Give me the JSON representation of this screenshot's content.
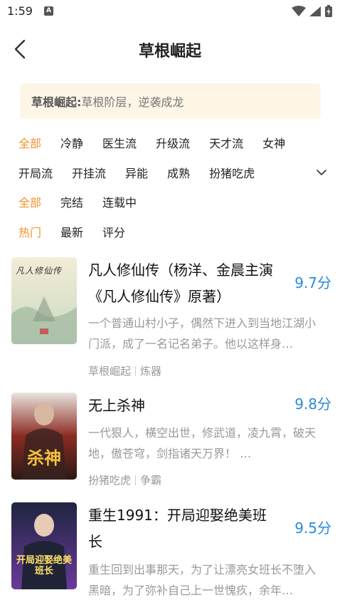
{
  "status": {
    "time": "1:59",
    "notification_letter": "A"
  },
  "header": {
    "title": "草根崛起"
  },
  "banner": {
    "label": "草根崛起:",
    "text": "草根阶层，逆袭成龙"
  },
  "filters": {
    "category_row1": [
      "全部",
      "冷静",
      "医生流",
      "升级流",
      "天才流",
      "女神"
    ],
    "category_row2": [
      "开局流",
      "开挂流",
      "异能",
      "成熟",
      "扮猪吃虎"
    ],
    "status_options": [
      "全部",
      "完结",
      "连载中"
    ],
    "sort_options": [
      "热门",
      "最新",
      "评分"
    ]
  },
  "books": [
    {
      "title": "凡人修仙传（杨洋、金晨主演《凡人修仙传》原著）",
      "score": "9.7分",
      "desc": "一个普通山村小子，偶然下进入到当地江湖小门派，成了一名记名弟子。他以这样身…",
      "tag1": "草根崛起",
      "tag2": "炼器",
      "cover_text": "凡人修仙传"
    },
    {
      "title": "无上杀神",
      "score": "9.8分",
      "desc": "一代狠人，横空出世，修武道，凌九霄，破天地，傲苍穹，剑指诸天万界！ …",
      "tag1": "扮猪吃虎",
      "tag2": "争霸",
      "cover_text": "杀神"
    },
    {
      "title": "重生1991：开局迎娶绝美班长",
      "score": "9.5分",
      "desc": "重生回到出事那天，为了让漂亮女班长不堕入黑暗，为了弥补自己上一世愧疚，余年…",
      "cover_text": "开局迎娶绝美班长"
    }
  ],
  "colors": {
    "accent": "#f2932a",
    "score": "#2b8ad8",
    "banner_bg": "#fdf6e6"
  }
}
